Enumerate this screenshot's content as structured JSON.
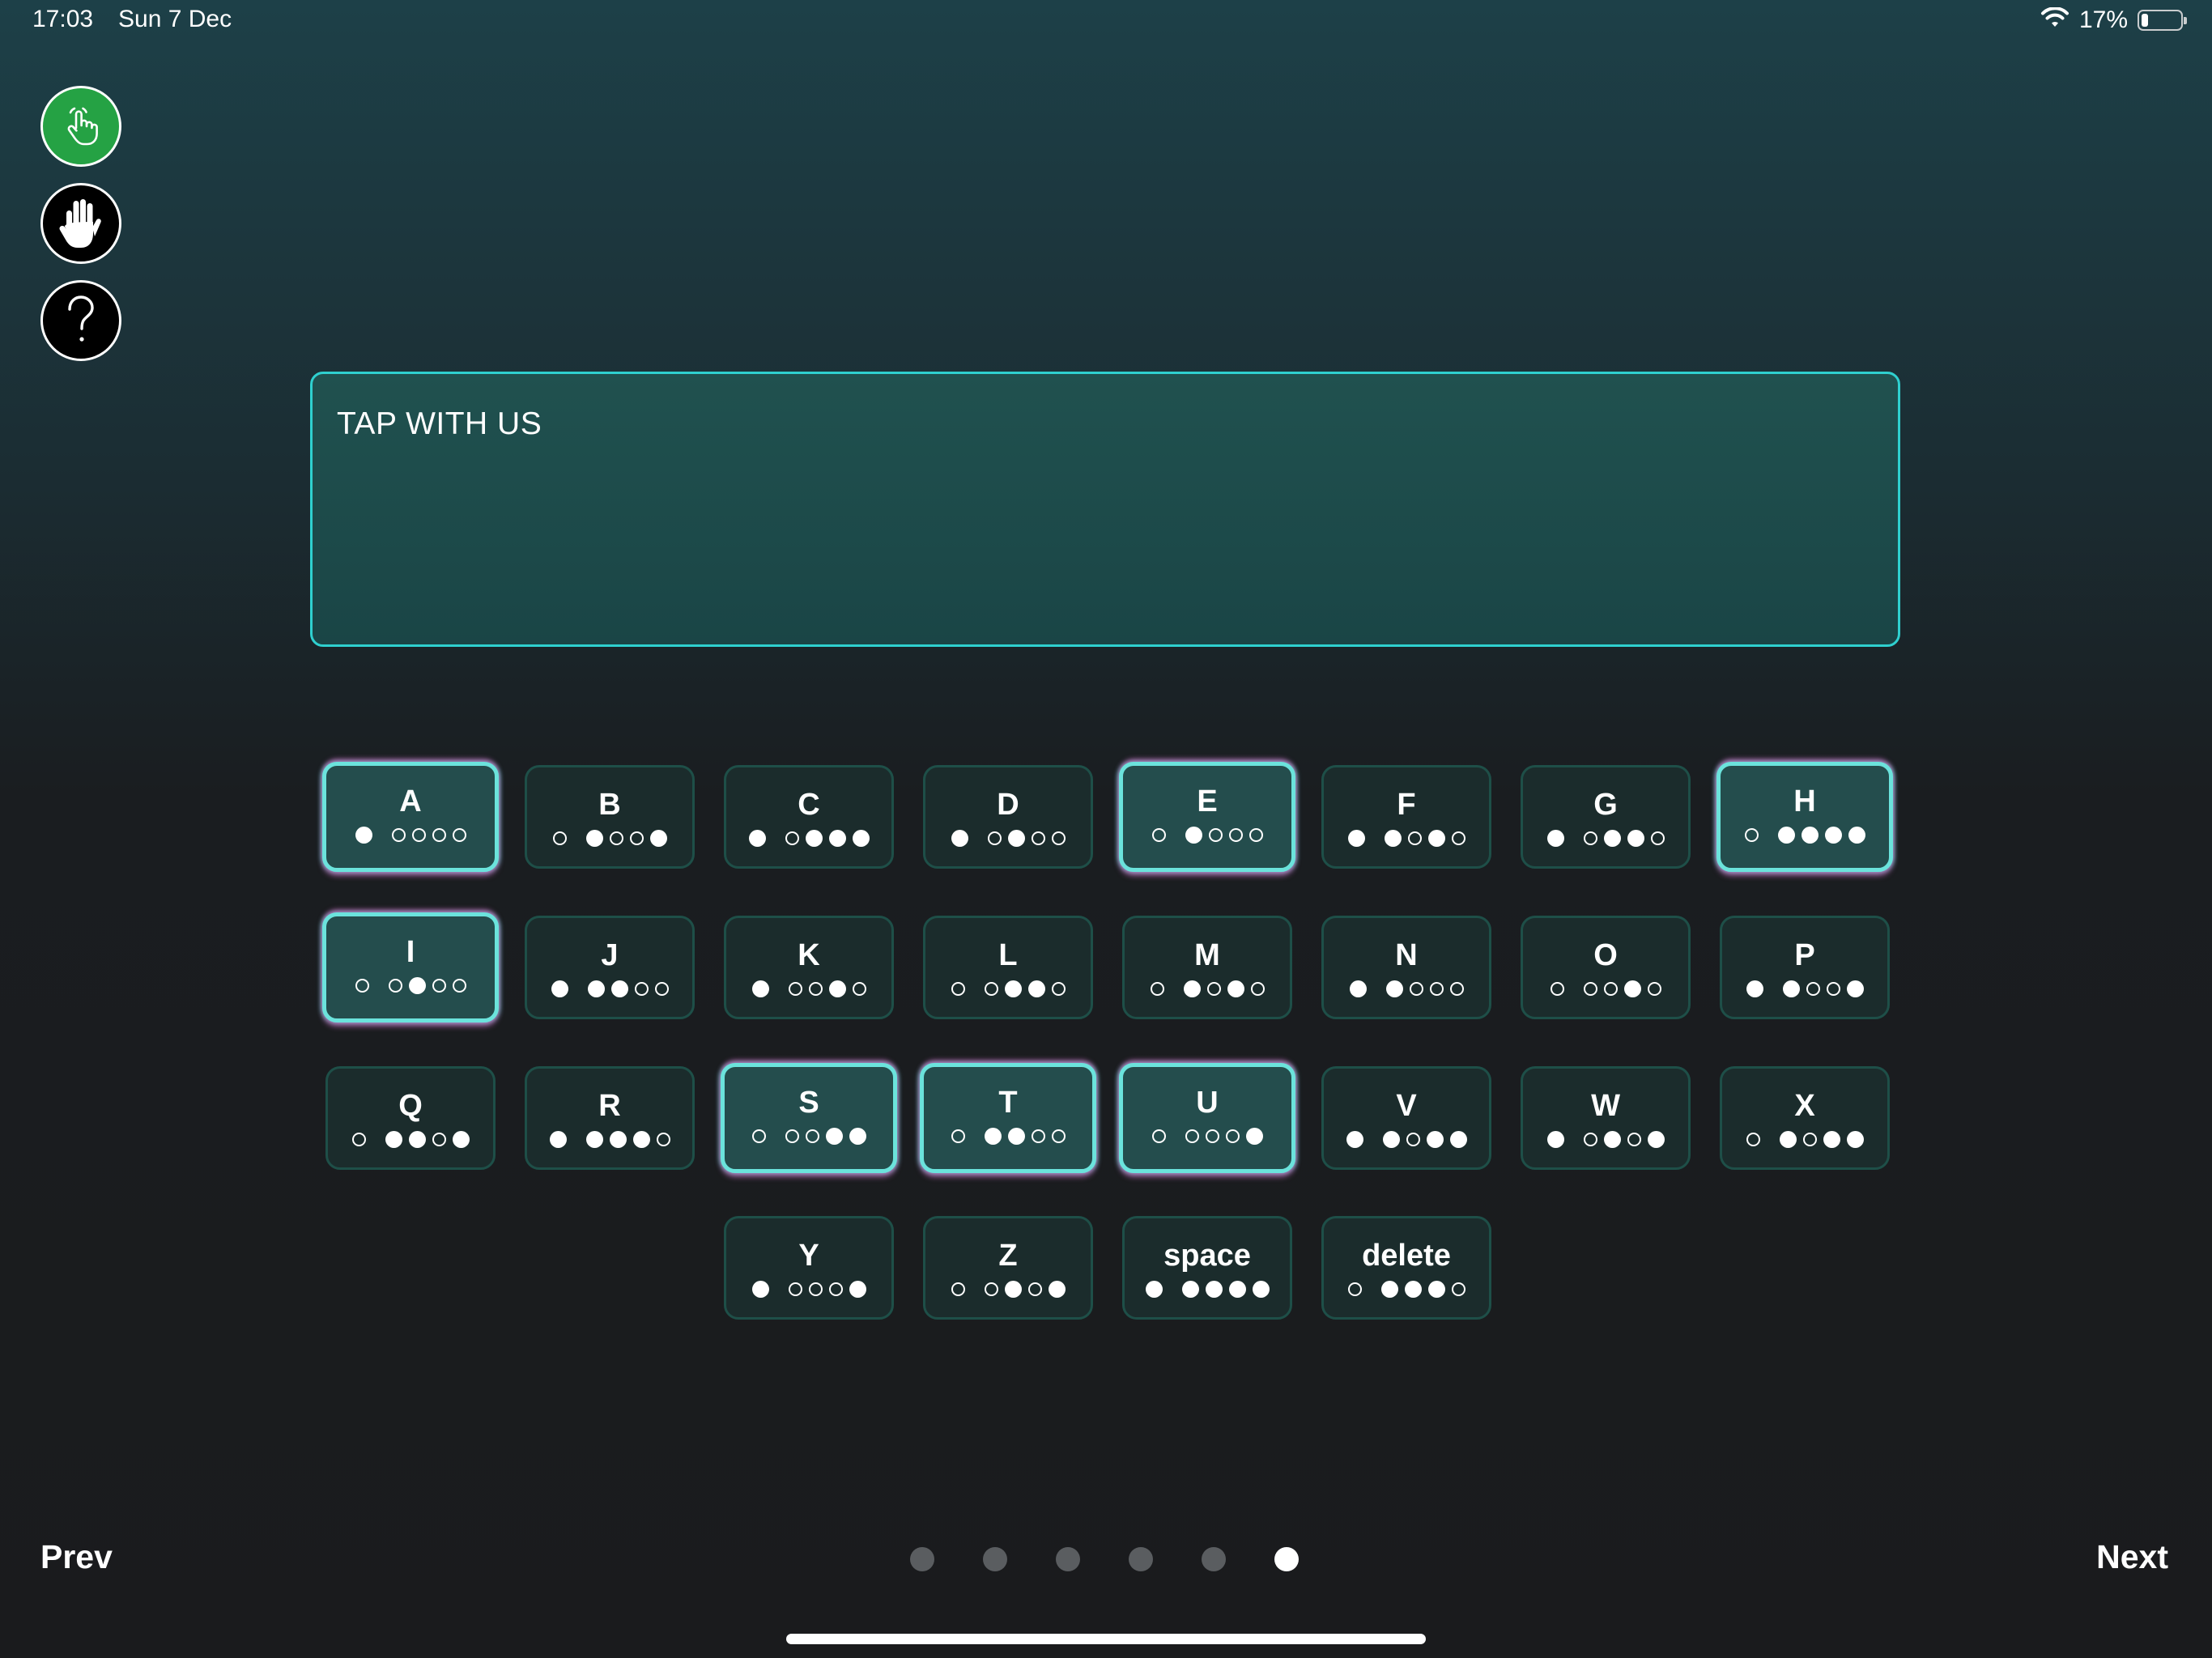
{
  "status_bar": {
    "time": "17:03",
    "date": "Sun 7 Dec",
    "battery_percent": "17%",
    "battery_level": 0.17
  },
  "side_buttons": [
    {
      "name": "tap-mode-button",
      "icon": "pointing-hand-icon",
      "color": "#25a244"
    },
    {
      "name": "stop-hand-button",
      "icon": "raised-hand-icon",
      "color": "#000000"
    },
    {
      "name": "help-button",
      "icon": "question-mark-icon",
      "color": "#000000"
    }
  ],
  "text_display": {
    "text": "TAP WITH US"
  },
  "keyboard": {
    "keys": [
      {
        "label": "A",
        "pattern": "1 0000",
        "active": true
      },
      {
        "label": "B",
        "pattern": "0 1001",
        "active": false
      },
      {
        "label": "C",
        "pattern": "1 0111",
        "active": false
      },
      {
        "label": "D",
        "pattern": "1 0100",
        "active": false
      },
      {
        "label": "E",
        "pattern": "0 1000",
        "active": true
      },
      {
        "label": "F",
        "pattern": "1 1010",
        "active": false
      },
      {
        "label": "G",
        "pattern": "1 0110",
        "active": false
      },
      {
        "label": "H",
        "pattern": "0 1111",
        "active": true
      },
      {
        "label": "I",
        "pattern": "0 0100",
        "active": true
      },
      {
        "label": "J",
        "pattern": "1 1100",
        "active": false
      },
      {
        "label": "K",
        "pattern": "1 0010",
        "active": false
      },
      {
        "label": "L",
        "pattern": "0 0110",
        "active": false
      },
      {
        "label": "M",
        "pattern": "0 1010",
        "active": false
      },
      {
        "label": "N",
        "pattern": "1 1000",
        "active": false
      },
      {
        "label": "O",
        "pattern": "0 0010",
        "active": false
      },
      {
        "label": "P",
        "pattern": "1 1001",
        "active": false
      },
      {
        "label": "Q",
        "pattern": "0 1101",
        "active": false
      },
      {
        "label": "R",
        "pattern": "1 1110",
        "active": false
      },
      {
        "label": "S",
        "pattern": "0 0011",
        "active": true
      },
      {
        "label": "T",
        "pattern": "0 1100",
        "active": true
      },
      {
        "label": "U",
        "pattern": "0 0001",
        "active": true
      },
      {
        "label": "V",
        "pattern": "1 1011",
        "active": false
      },
      {
        "label": "W",
        "pattern": "1 0101",
        "active": false
      },
      {
        "label": "X",
        "pattern": "0 1011",
        "active": false
      },
      {
        "label": "Y",
        "pattern": "1 0001",
        "active": false
      },
      {
        "label": "Z",
        "pattern": "0 0101",
        "active": false
      },
      {
        "label": "space",
        "pattern": "1 1111",
        "active": false
      },
      {
        "label": "delete",
        "pattern": "0 1110",
        "active": false
      }
    ]
  },
  "navigation": {
    "prev_label": "Prev",
    "next_label": "Next",
    "page_count": 6,
    "current_page": 6
  }
}
